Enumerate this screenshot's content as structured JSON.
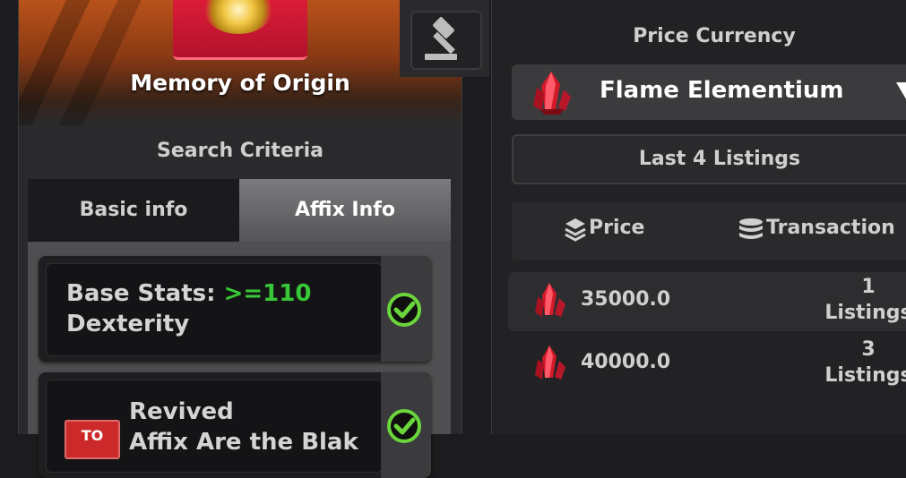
{
  "item": {
    "name": "Memory of Origin"
  },
  "search": {
    "title": "Search Criteria",
    "tabs": [
      {
        "label": "Basic info",
        "active": false
      },
      {
        "label": "Affix Info",
        "active": true
      }
    ],
    "affixes": [
      {
        "prefix": "Base Stats: ",
        "threshold": ">=110",
        "stat": "Dexterity",
        "checked": true
      },
      {
        "badge": "TO",
        "line1": "Revived",
        "line2": "Affix Are the Blak",
        "checked": true
      }
    ]
  },
  "right": {
    "title": "Price Currency",
    "currency": "Flame Elementium",
    "last_listings_label": "Last 4 Listings",
    "columns": {
      "price": "Price",
      "transaction": "Transaction"
    },
    "rows": [
      {
        "price": "35000.0",
        "count": "1",
        "unit": "Listings"
      },
      {
        "price": "40000.0",
        "count": "3",
        "unit": "Listings"
      }
    ]
  },
  "colors": {
    "accent_green": "#37c837",
    "card_red": "#e11d3a"
  },
  "icons": {
    "auction": "gavel-icon",
    "currency": "crystal-icon",
    "check": "check-circle-icon",
    "dropdown": "triangle-down-icon"
  }
}
